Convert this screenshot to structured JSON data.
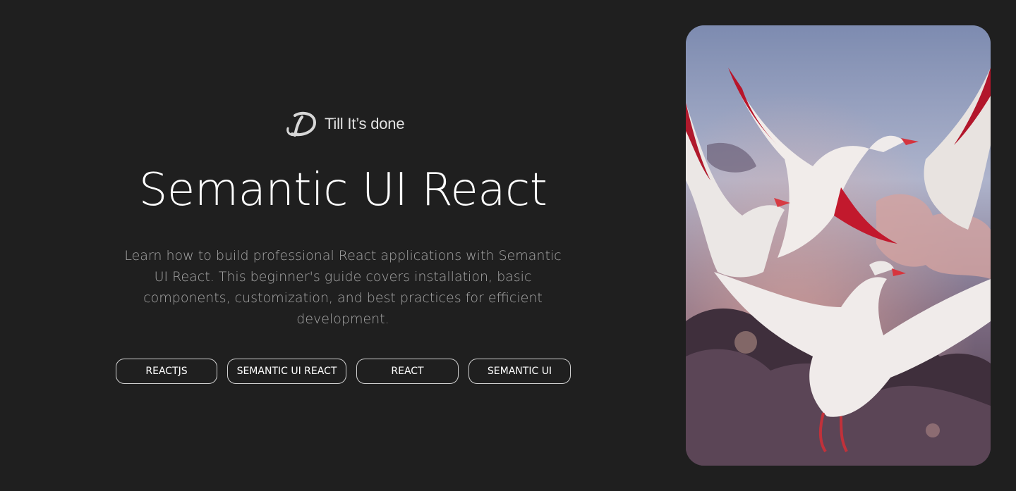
{
  "brand": {
    "logo_icon": "stylized-d-icon",
    "name": "Till It’s done"
  },
  "hero": {
    "title": "Semantic UI React",
    "description": "Learn how to build professional React applications with Semantic UI React. This beginner's guide covers installation, basic components, customization, and best practices for efficient development."
  },
  "tags": [
    {
      "label": "REACTJS"
    },
    {
      "label": "SEMANTIC UI REACT"
    },
    {
      "label": "REACT"
    },
    {
      "label": "SEMANTIC UI"
    }
  ],
  "image": {
    "subject": "white doves with red-tipped wings flying in a sunset sky"
  },
  "colors": {
    "background": "#1f1f1f",
    "text": "#ffffff",
    "muted_text": "#a6a6a6",
    "tag_border": "#d0d0d0"
  }
}
